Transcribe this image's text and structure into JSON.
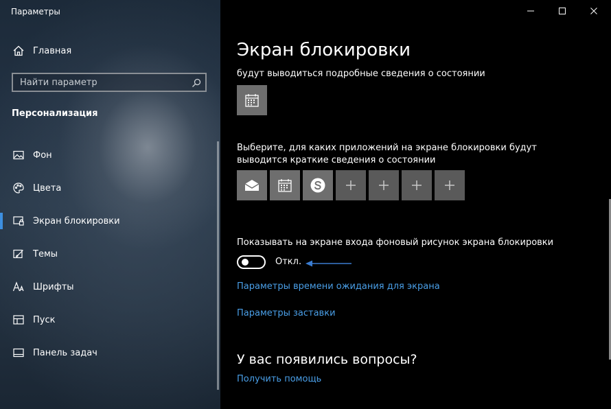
{
  "window": {
    "title": "Параметры",
    "controls": {
      "minimize_icon": "minimize-icon",
      "maximize_icon": "maximize-icon",
      "close_icon": "close-icon"
    }
  },
  "sidebar": {
    "home": {
      "label": "Главная",
      "icon": "home-icon"
    },
    "search": {
      "placeholder": "Найти параметр",
      "value": ""
    },
    "section": "Персонализация",
    "items": [
      {
        "label": "Фон",
        "icon": "image-icon",
        "active": false
      },
      {
        "label": "Цвета",
        "icon": "palette-icon",
        "active": false
      },
      {
        "label": "Экран блокировки",
        "icon": "lock-screen-icon",
        "active": true
      },
      {
        "label": "Темы",
        "icon": "themes-icon",
        "active": false
      },
      {
        "label": "Шрифты",
        "icon": "fonts-icon",
        "active": false
      },
      {
        "label": "Пуск",
        "icon": "start-icon",
        "active": false
      },
      {
        "label": "Панель задач",
        "icon": "taskbar-icon",
        "active": false
      }
    ],
    "accent": "#3d8fe0"
  },
  "main": {
    "title": "Экран блокировки",
    "detailed_status_text": "будут выводиться подробные сведения о состоянии",
    "detailed_app": {
      "icon": "calendar-icon"
    },
    "quick_status_text_line1": "Выберите, для каких приложений на экране блокировки будут",
    "quick_status_text_line2": "выводится краткие сведения о состоянии",
    "quick_apps": [
      {
        "icon": "mail-icon"
      },
      {
        "icon": "calendar-icon"
      },
      {
        "icon": "skype-icon"
      },
      {
        "icon": "plus-icon"
      },
      {
        "icon": "plus-icon"
      },
      {
        "icon": "plus-icon"
      },
      {
        "icon": "plus-icon"
      }
    ],
    "signin_bg_label": "Показывать на экране входа фоновый рисунок экрана блокировки",
    "signin_bg_toggle": {
      "state": "Откл.",
      "on": false
    },
    "links": {
      "screen_timeout": "Параметры времени ожидания для экрана",
      "screensaver": "Параметры заставки"
    },
    "questions": {
      "title": "У вас появились вопросы?",
      "help_link": "Получить помощь"
    },
    "link_color": "#4a9fe8",
    "arrow_color": "#3a7cd0"
  }
}
